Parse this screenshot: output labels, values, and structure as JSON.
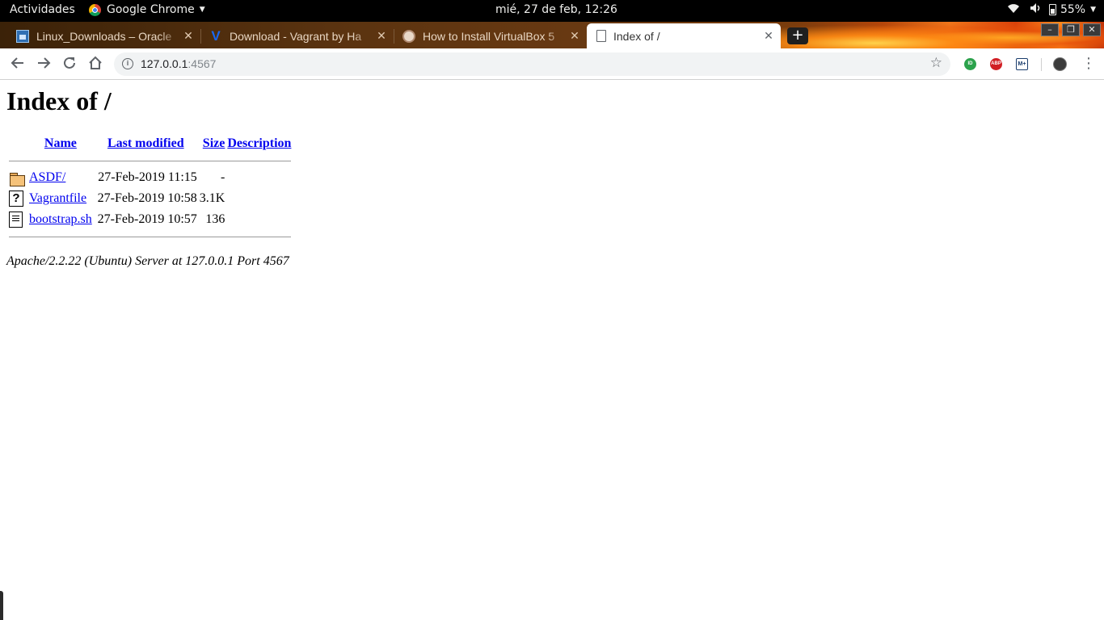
{
  "topbar": {
    "activities": "Actividades",
    "app_name": "Google Chrome",
    "clock": "mié, 27 de feb, 12:26",
    "battery": "55%"
  },
  "tabs": [
    {
      "title": "Linux_Downloads – Oracle",
      "favicon": "oracle-favicon",
      "active": false
    },
    {
      "title": "Download - Vagrant by Ha",
      "favicon": "vagrant-favicon",
      "active": false
    },
    {
      "title": "How to Install VirtualBox 5",
      "favicon": "howto-favicon",
      "active": false
    },
    {
      "title": "Index of /",
      "favicon": "document-favicon",
      "active": true
    }
  ],
  "toolbar": {
    "url_host": "127.0.0.1",
    "url_port": ":4567"
  },
  "extensions": {
    "ext1": "ID",
    "ext2": "ABP",
    "ext3": "M+"
  },
  "listing": {
    "title": "Index of /",
    "headers": {
      "name": "Name",
      "last_modified": "Last modified",
      "size": "Size",
      "description": "Description"
    },
    "rows": [
      {
        "icon": "folder-icon",
        "name": "ASDF/",
        "modified": "27-Feb-2019 11:15",
        "size": "-",
        "description": ""
      },
      {
        "icon": "unknown-file-icon",
        "name": "Vagrantfile",
        "modified": "27-Feb-2019 10:58",
        "size": "3.1K",
        "description": ""
      },
      {
        "icon": "text-file-icon",
        "name": "bootstrap.sh",
        "modified": "27-Feb-2019 10:57",
        "size": "136",
        "description": ""
      }
    ],
    "footer": "Apache/2.2.22 (Ubuntu) Server at 127.0.0.1 Port 4567"
  }
}
